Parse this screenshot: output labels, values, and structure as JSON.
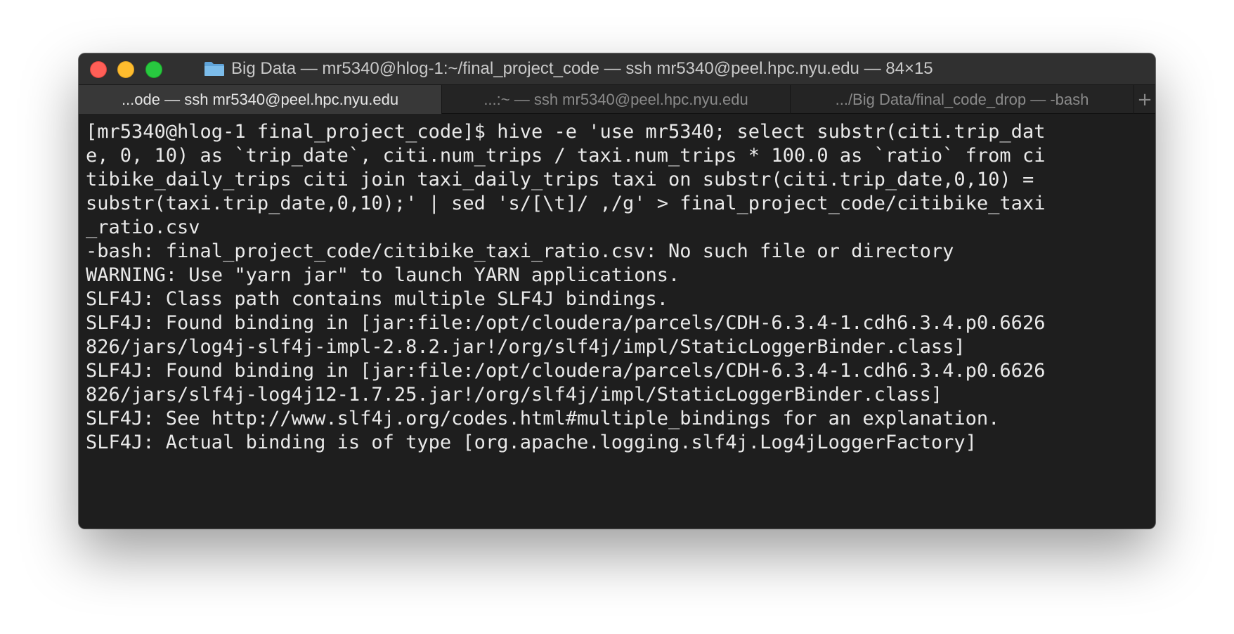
{
  "window": {
    "title": "Big Data — mr5340@hlog-1:~/final_project_code — ssh mr5340@peel.hpc.nyu.edu — 84×15",
    "folder_icon": "folder-icon",
    "colors": {
      "close": "#ff5f57",
      "minimize": "#febc2e",
      "maximize": "#28c840",
      "background": "#1e1e1e",
      "text": "#e9e9e9"
    }
  },
  "tabs": [
    {
      "label": "...ode — ssh mr5340@peel.hpc.nyu.edu",
      "active": true
    },
    {
      "label": "...:~ — ssh mr5340@peel.hpc.nyu.edu",
      "active": false
    },
    {
      "label": ".../Big Data/final_code_drop — -bash",
      "active": false
    }
  ],
  "new_tab_label": "+",
  "terminal": {
    "lines": [
      "[mr5340@hlog-1 final_project_code]$ hive -e 'use mr5340; select substr(citi.trip_dat",
      "e, 0, 10) as `trip_date`, citi.num_trips / taxi.num_trips * 100.0 as `ratio` from ci",
      "tibike_daily_trips citi join taxi_daily_trips taxi on substr(citi.trip_date,0,10) =",
      "substr(taxi.trip_date,0,10);' | sed 's/[\\t]/ ,/g' > final_project_code/citibike_taxi",
      "_ratio.csv",
      "-bash: final_project_code/citibike_taxi_ratio.csv: No such file or directory",
      "WARNING: Use \"yarn jar\" to launch YARN applications.",
      "SLF4J: Class path contains multiple SLF4J bindings.",
      "SLF4J: Found binding in [jar:file:/opt/cloudera/parcels/CDH-6.3.4-1.cdh6.3.4.p0.6626",
      "826/jars/log4j-slf4j-impl-2.8.2.jar!/org/slf4j/impl/StaticLoggerBinder.class]",
      "SLF4J: Found binding in [jar:file:/opt/cloudera/parcels/CDH-6.3.4-1.cdh6.3.4.p0.6626",
      "826/jars/slf4j-log4j12-1.7.25.jar!/org/slf4j/impl/StaticLoggerBinder.class]",
      "SLF4J: See http://www.slf4j.org/codes.html#multiple_bindings for an explanation.",
      "SLF4J: Actual binding is of type [org.apache.logging.slf4j.Log4jLoggerFactory]",
      ""
    ]
  }
}
